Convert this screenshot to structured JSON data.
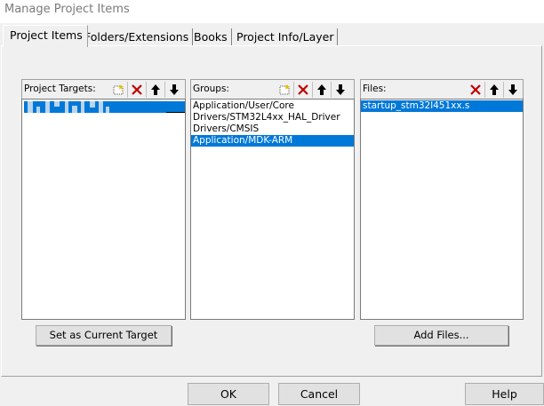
{
  "window": {
    "title": "Manage Project Items"
  },
  "tabs": [
    {
      "label": "Project Items",
      "active": true
    },
    {
      "label": "Folders/Extensions",
      "active": false
    },
    {
      "label": "Books",
      "active": false
    },
    {
      "label": "Project Info/Layer",
      "active": false
    }
  ],
  "project_targets": {
    "label": "Project Targets:",
    "tools": [
      "new-icon",
      "delete-icon",
      "move-up-icon",
      "move-down-icon"
    ],
    "items": []
  },
  "groups": {
    "label": "Groups:",
    "tools": [
      "new-icon",
      "delete-icon",
      "move-up-icon",
      "move-down-icon"
    ],
    "items": [
      {
        "label": "Application/User/Core",
        "selected": false
      },
      {
        "label": "Drivers/STM32L4xx_HAL_Driver",
        "selected": false
      },
      {
        "label": "Drivers/CMSIS",
        "selected": false
      },
      {
        "label": "Application/MDK-ARM",
        "selected": true
      }
    ]
  },
  "files": {
    "label": "Files:",
    "tools": [
      "delete-icon",
      "move-up-icon",
      "move-down-icon"
    ],
    "items": [
      {
        "label": "startup_stm32l451xx.s",
        "selected": true
      }
    ]
  },
  "buttons": {
    "set_current_target": "Set as Current Target",
    "add_files": "Add Files...",
    "ok": "OK",
    "cancel": "Cancel",
    "help": "Help"
  },
  "colors": {
    "selection": "#0078d7",
    "delete_red": "#c00000",
    "dialog_bg": "#f0f0f0"
  }
}
